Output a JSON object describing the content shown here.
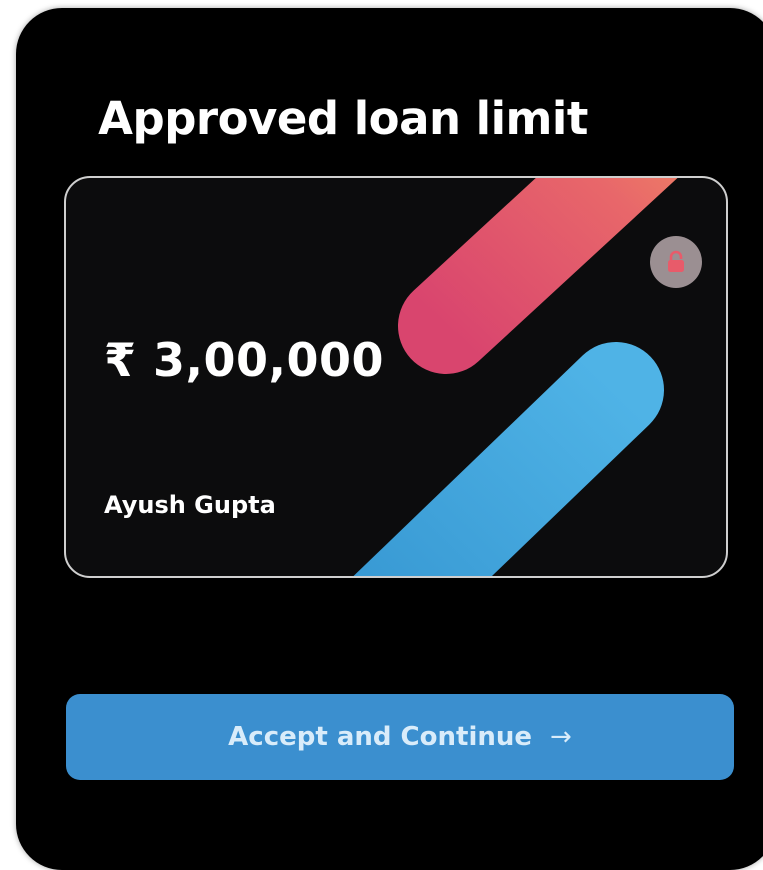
{
  "screen": {
    "title": "Approved loan limit"
  },
  "card": {
    "amount": "₹ 3,00,000",
    "holder_name": "Ayush Gupta",
    "lock_icon": "lock-icon",
    "colors": {
      "background": "#0c0c0d",
      "stripe_top_start": "#d9456e",
      "stripe_top_end": "#f59b5f",
      "stripe_bottom": "#44a9e0"
    }
  },
  "actions": {
    "accept_label": "Accept and Continue",
    "accept_arrow": "→",
    "accept_color": "#3b8fcf"
  }
}
